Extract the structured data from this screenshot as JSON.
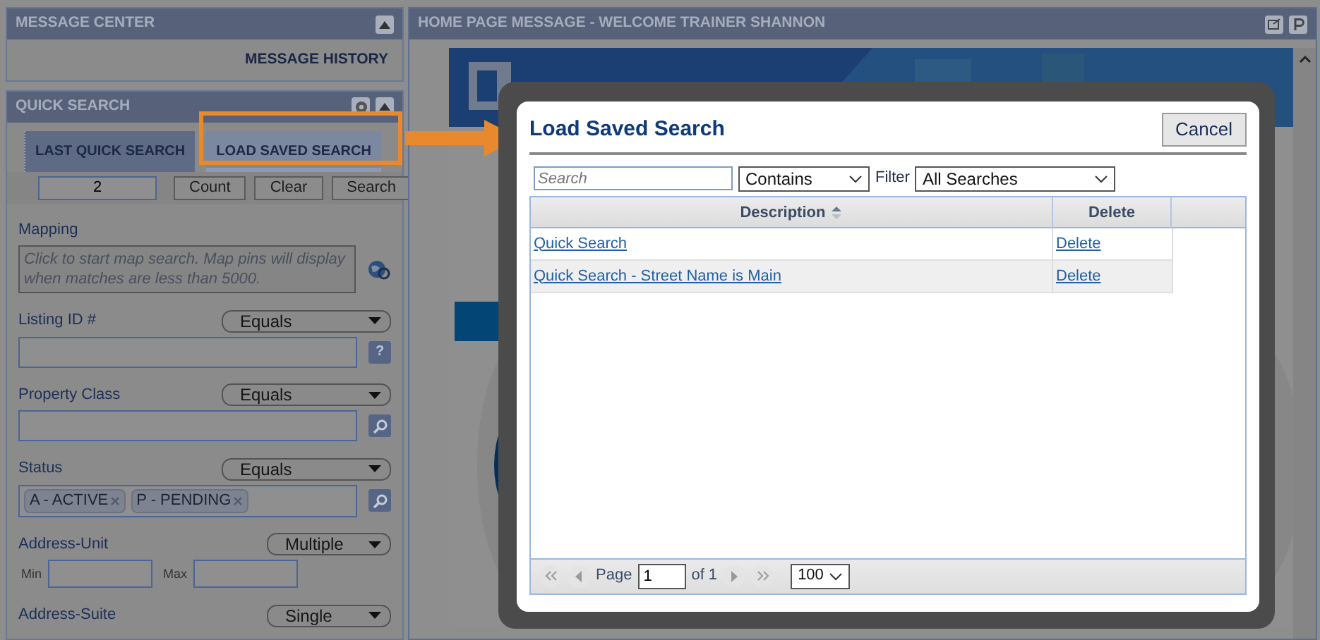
{
  "message_center": {
    "title": "MESSAGE CENTER",
    "link": "MESSAGE HISTORY"
  },
  "quick_search": {
    "title": "QUICK SEARCH",
    "tabs": [
      {
        "label": "LAST QUICK SEARCH",
        "selected": false
      },
      {
        "label": "LOAD SAVED SEARCH",
        "selected": true
      }
    ],
    "count_value": "2",
    "buttons": [
      "Count",
      "Clear",
      "Search"
    ],
    "fields": [
      {
        "kind": "map",
        "label": "Mapping",
        "placeholder": "Click to start map search. Map pins will display when matches are less than 5000."
      },
      {
        "kind": "text",
        "label": "Listing ID #",
        "operator": "Equals",
        "action": {
          "kind": "help",
          "label": "?"
        }
      },
      {
        "kind": "text",
        "label": "Property Class",
        "operator": "Equals",
        "action": {
          "kind": "lookup"
        }
      },
      {
        "kind": "tags",
        "label": "Status",
        "operator": "Equals",
        "action": {
          "kind": "lookup"
        },
        "tags": [
          "A - ACTIVE",
          "P - PENDING"
        ]
      },
      {
        "kind": "range",
        "label": "Address-Unit",
        "operator": "Multiple",
        "min_label": "Min",
        "max_label": "Max"
      },
      {
        "kind": "header",
        "label": "Address-Suite",
        "operator": "Single"
      }
    ]
  },
  "home_message": {
    "title": "HOME PAGE MESSAGE - WELCOME TRAINER SHANNON"
  },
  "dialog": {
    "title": "Load Saved Search",
    "cancel": "Cancel",
    "search_placeholder": "Search",
    "match": "Contains",
    "filter_label": "Filter",
    "filter": "All Searches",
    "columns": [
      "Description",
      "Delete"
    ],
    "rows": [
      {
        "description": "Quick Search",
        "delete": "Delete"
      },
      {
        "description": "Quick Search - Street Name is Main",
        "delete": "Delete"
      }
    ],
    "pager": {
      "page_label": "Page",
      "page": "1",
      "of": "of 1",
      "page_size": "100"
    }
  }
}
